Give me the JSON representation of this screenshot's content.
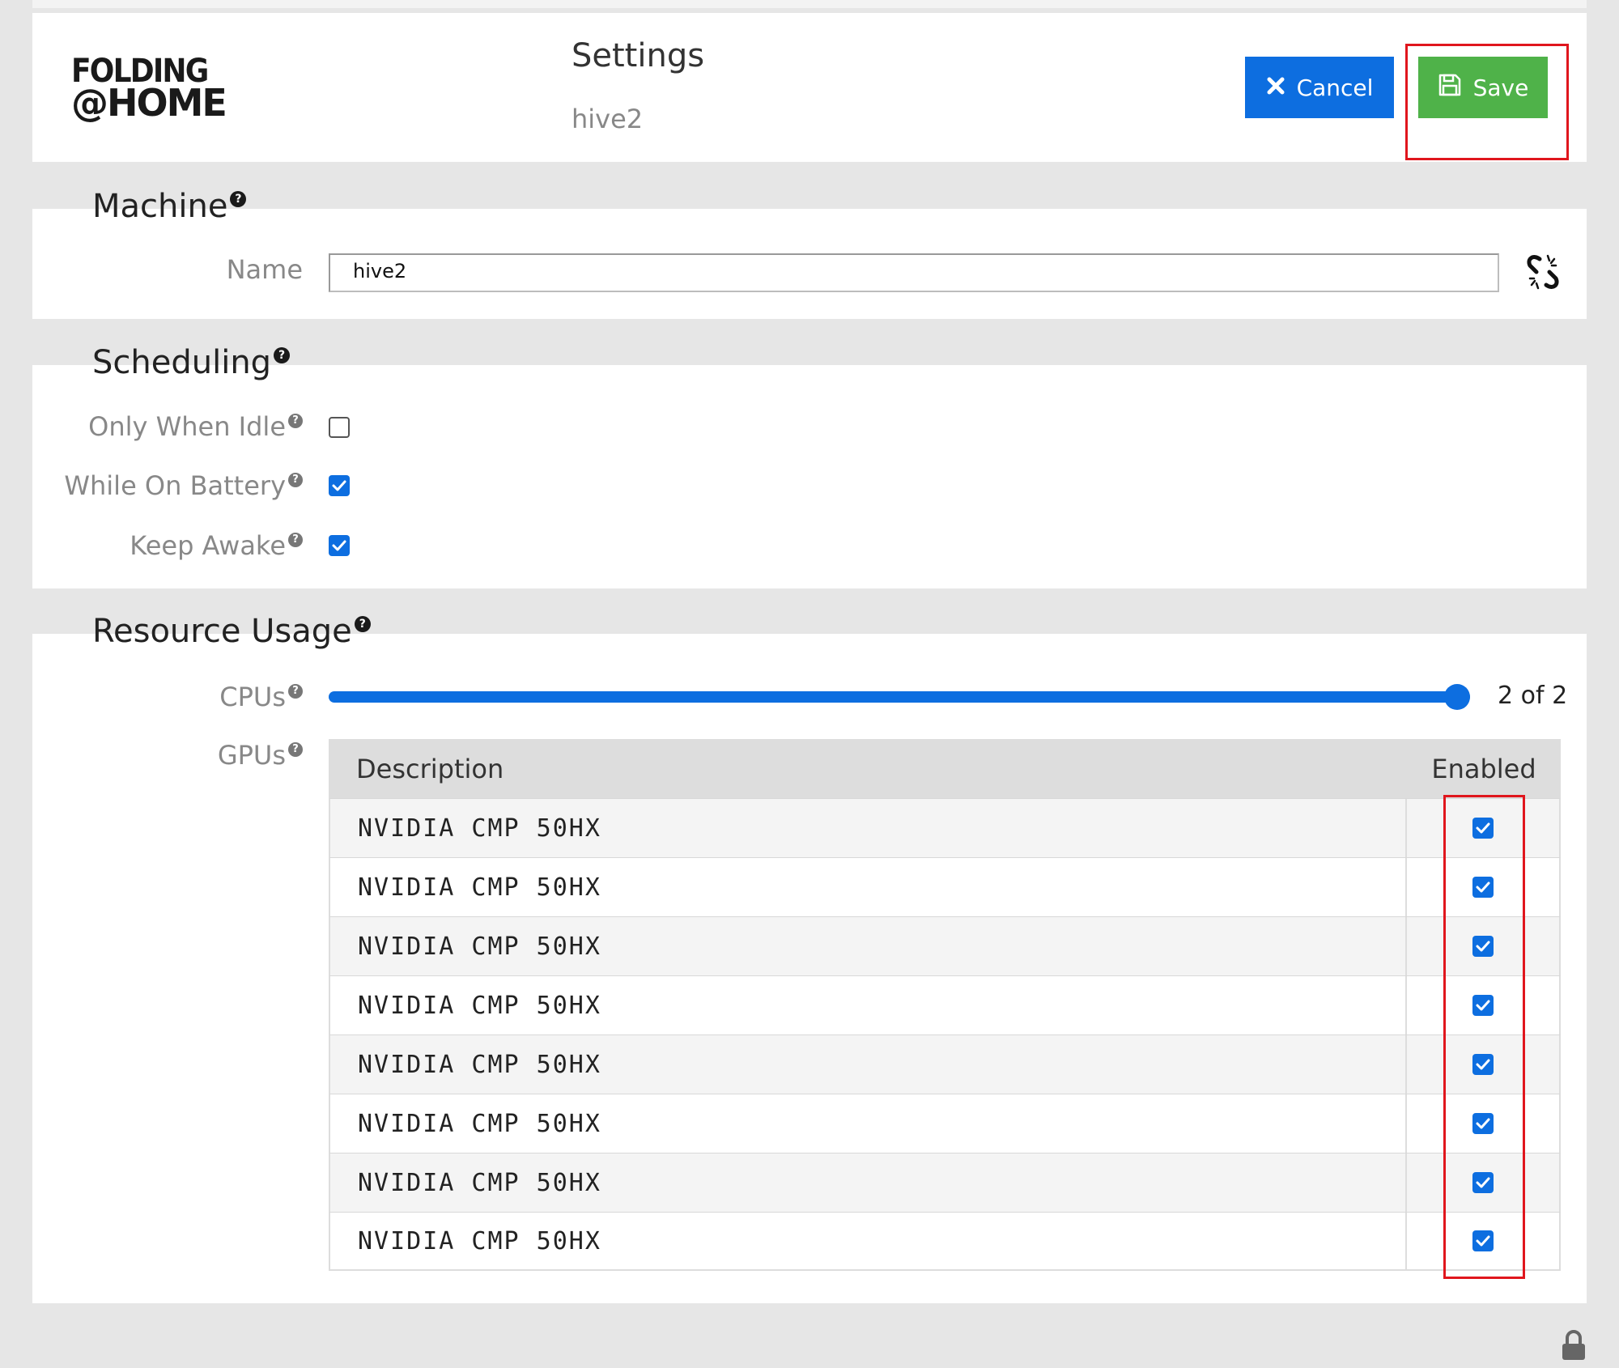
{
  "app": {
    "logo_line1": "FOLDING",
    "logo_line2": "@HOME",
    "title": "Settings",
    "subtitle": "hive2"
  },
  "actions": {
    "cancel_label": "Cancel",
    "save_label": "Save"
  },
  "machine": {
    "heading": "Machine",
    "name_label": "Name",
    "name_value": "hive2",
    "help_icon": "question-circle-icon",
    "link_icon": "unlink-icon"
  },
  "scheduling": {
    "heading": "Scheduling",
    "options": [
      {
        "label": "Only When Idle",
        "checked": false
      },
      {
        "label": "While On Battery",
        "checked": true
      },
      {
        "label": "Keep Awake",
        "checked": true
      }
    ]
  },
  "resources": {
    "heading": "Resource Usage",
    "cpus_label": "CPUs",
    "cpus_value_text": "2 of 2",
    "cpus_value": 2,
    "cpus_max": 2,
    "gpus_label": "GPUs",
    "table": {
      "col_description": "Description",
      "col_enabled": "Enabled",
      "rows": [
        {
          "description": "NVIDIA CMP 50HX",
          "enabled": true
        },
        {
          "description": "NVIDIA CMP 50HX",
          "enabled": true
        },
        {
          "description": "NVIDIA CMP 50HX",
          "enabled": true
        },
        {
          "description": "NVIDIA CMP 50HX",
          "enabled": true
        },
        {
          "description": "NVIDIA CMP 50HX",
          "enabled": true
        },
        {
          "description": "NVIDIA CMP 50HX",
          "enabled": true
        },
        {
          "description": "NVIDIA CMP 50HX",
          "enabled": true
        },
        {
          "description": "NVIDIA CMP 50HX",
          "enabled": true
        }
      ]
    }
  },
  "colors": {
    "primary": "#0d6ee0",
    "save": "#4fb249",
    "highlight": "#e0161d"
  },
  "footer": {
    "lock_icon": "lock-icon"
  }
}
